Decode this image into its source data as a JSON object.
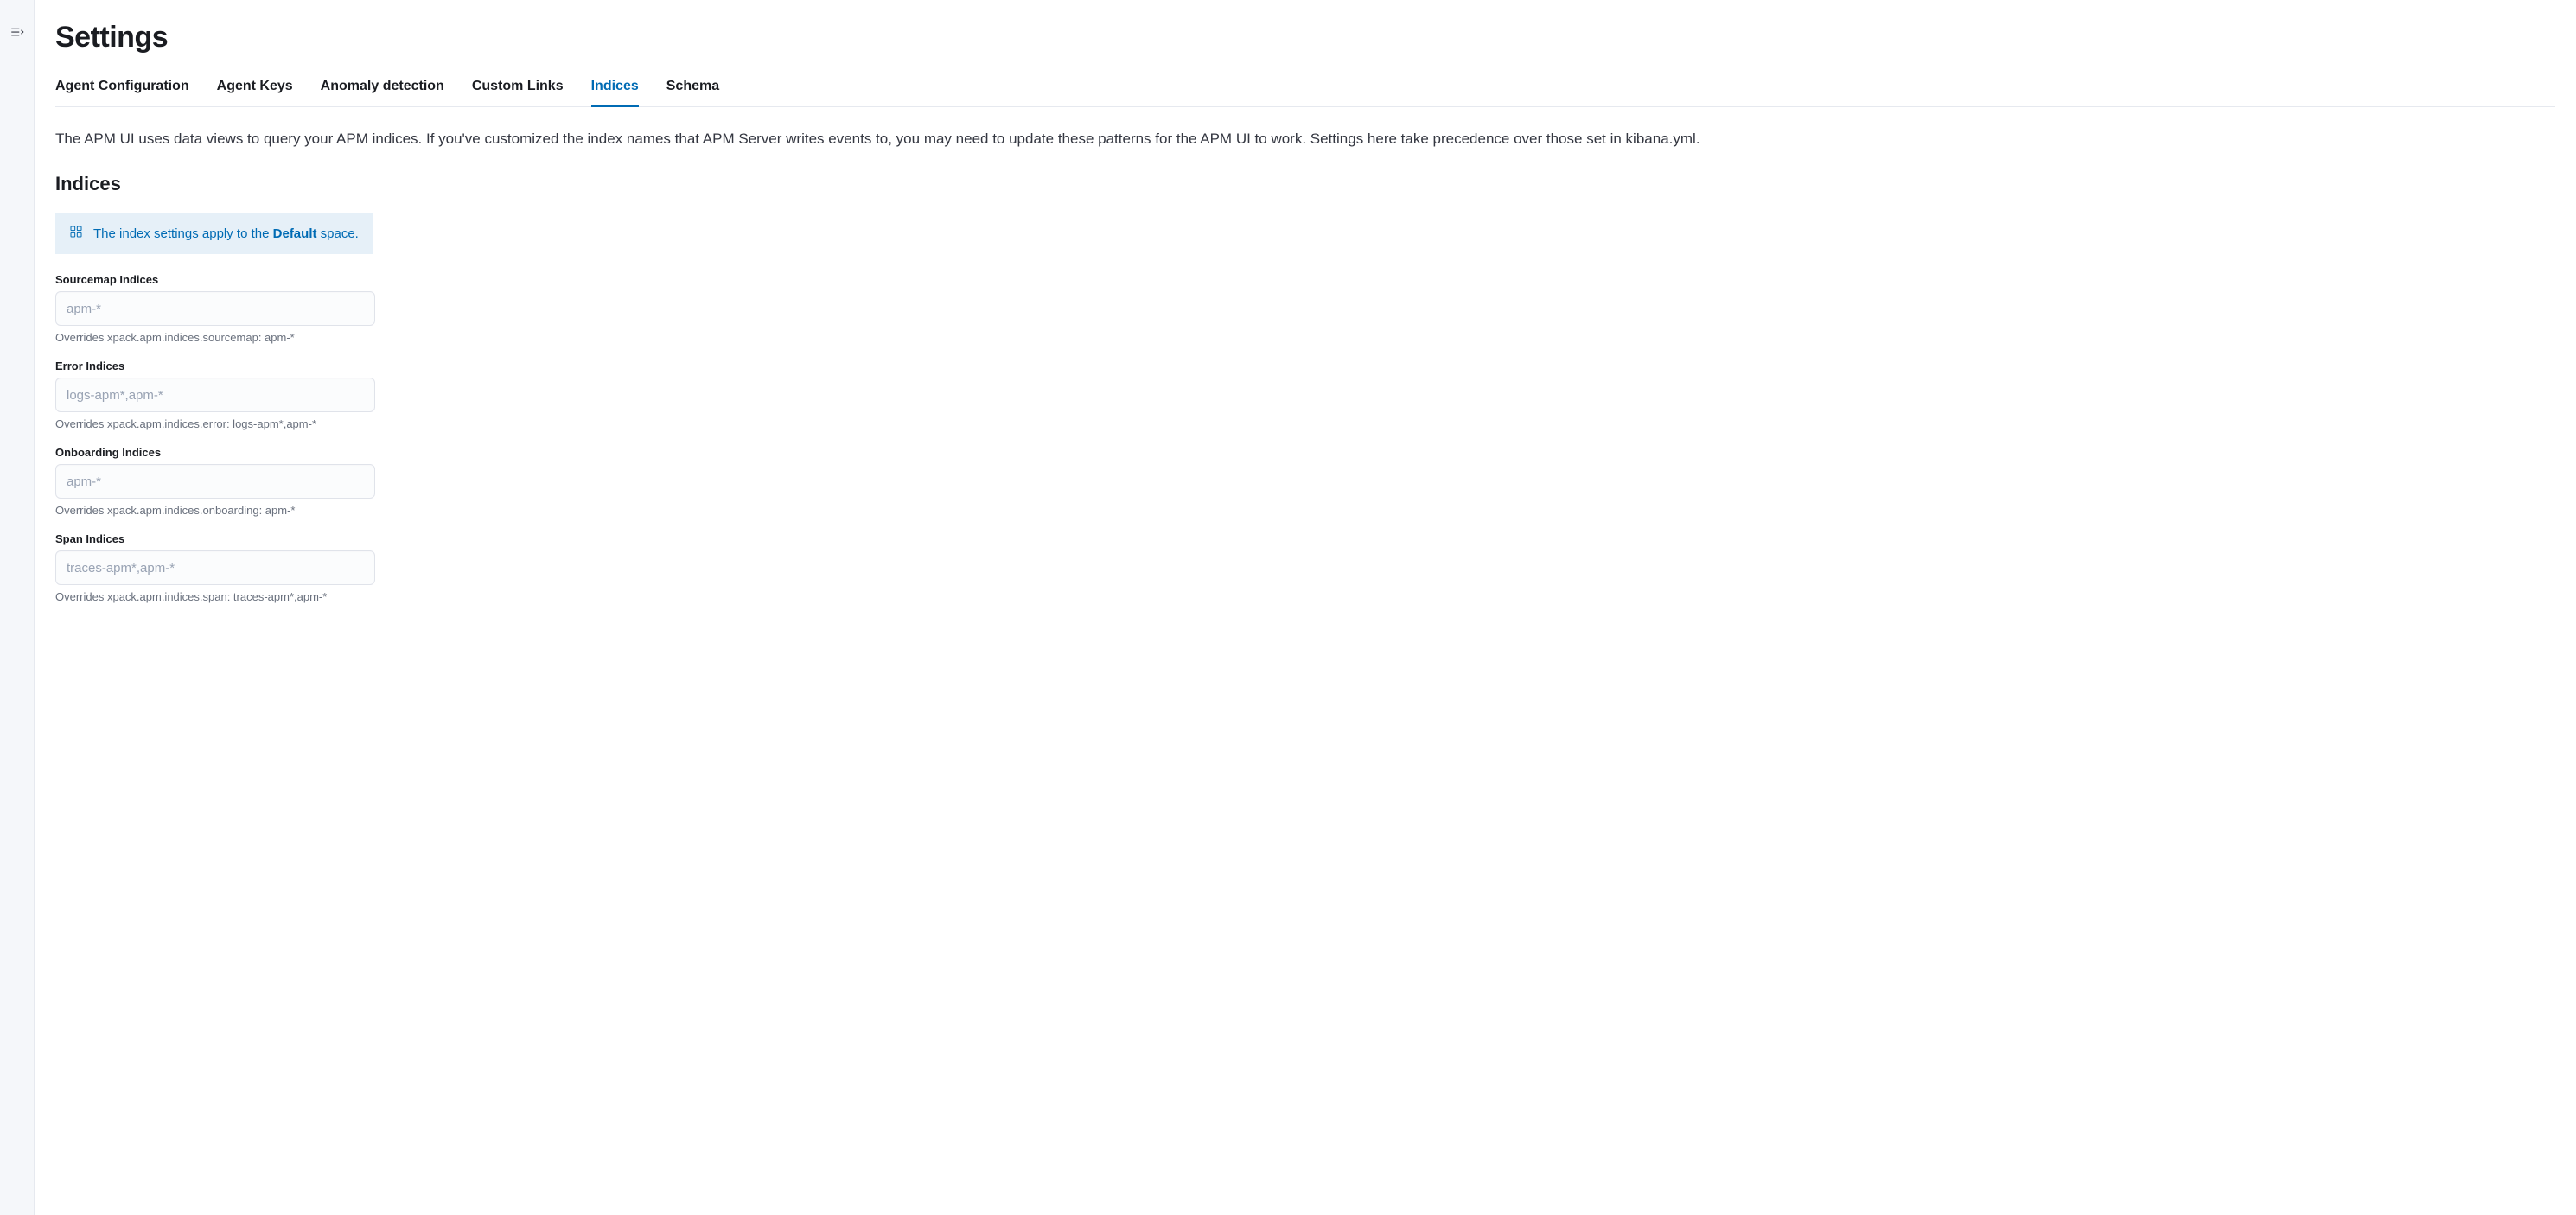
{
  "page": {
    "title": "Settings",
    "description": "The APM UI uses data views to query your APM indices. If you've customized the index names that APM Server writes events to, you may need to update these patterns for the APM UI to work. Settings here take precedence over those set in kibana.yml."
  },
  "tabs": [
    {
      "id": "agent-configuration",
      "label": "Agent Configuration",
      "active": false
    },
    {
      "id": "agent-keys",
      "label": "Agent Keys",
      "active": false
    },
    {
      "id": "anomaly-detection",
      "label": "Anomaly detection",
      "active": false
    },
    {
      "id": "custom-links",
      "label": "Custom Links",
      "active": false
    },
    {
      "id": "indices",
      "label": "Indices",
      "active": true
    },
    {
      "id": "schema",
      "label": "Schema",
      "active": false
    }
  ],
  "section": {
    "title": "Indices",
    "callout_pre": "The index settings apply to the ",
    "callout_bold": "Default",
    "callout_post": " space."
  },
  "fields": {
    "sourcemap": {
      "label": "Sourcemap Indices",
      "placeholder": "apm-*",
      "value": "",
      "help": "Overrides xpack.apm.indices.sourcemap: apm-*"
    },
    "error": {
      "label": "Error Indices",
      "placeholder": "logs-apm*,apm-*",
      "value": "",
      "help": "Overrides xpack.apm.indices.error: logs-apm*,apm-*"
    },
    "onboarding": {
      "label": "Onboarding Indices",
      "placeholder": "apm-*",
      "value": "",
      "help": "Overrides xpack.apm.indices.onboarding: apm-*"
    },
    "span": {
      "label": "Span Indices",
      "placeholder": "traces-apm*,apm-*",
      "value": "",
      "help": "Overrides xpack.apm.indices.span: traces-apm*,apm-*"
    }
  }
}
